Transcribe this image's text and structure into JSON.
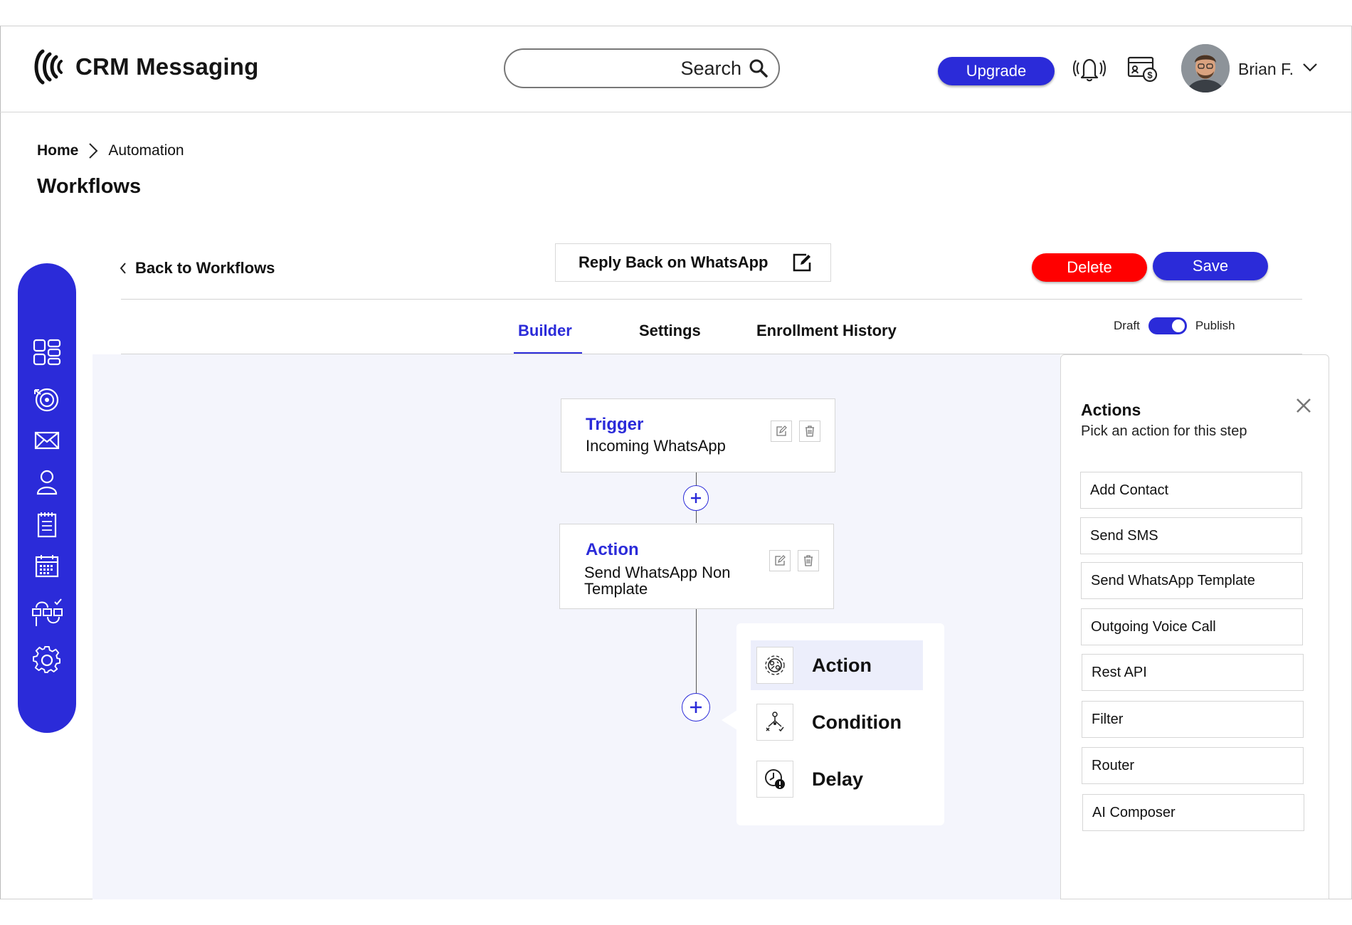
{
  "app": {
    "title": "CRM Messaging"
  },
  "header": {
    "search_placeholder": "Search",
    "upgrade_label": "Upgrade",
    "user_name": "Brian F."
  },
  "breadcrumb": {
    "home": "Home",
    "current": "Automation"
  },
  "page_title": "Workflows",
  "sidebar": {
    "icons": [
      "dashboard-icon",
      "target-icon",
      "mail-icon",
      "contacts-icon",
      "notes-icon",
      "calendar-icon",
      "workflow-icon",
      "settings-icon"
    ]
  },
  "toolbar": {
    "back_label": "Back to Workflows",
    "workflow_name": "Reply Back on WhatsApp",
    "delete_label": "Delete",
    "save_label": "Save"
  },
  "tabs": [
    {
      "label": "Builder",
      "active": true
    },
    {
      "label": "Settings",
      "active": false
    },
    {
      "label": "Enrollment History",
      "active": false
    }
  ],
  "status_toggle": {
    "left_label": "Draft",
    "right_label": "Publish",
    "state": "Publish"
  },
  "builder": {
    "trigger": {
      "title": "Trigger",
      "subtitle": "Incoming WhatsApp"
    },
    "action": {
      "title": "Action",
      "subtitle_line1": "Send WhatsApp Non",
      "subtitle_line2": "Template"
    },
    "step_menu": [
      {
        "label": "Action",
        "icon": "action-gear-icon",
        "highlighted": true
      },
      {
        "label": "Condition",
        "icon": "condition-branch-icon",
        "highlighted": false
      },
      {
        "label": "Delay",
        "icon": "delay-clock-icon",
        "highlighted": false
      }
    ]
  },
  "actions_panel": {
    "title": "Actions",
    "subtitle": "Pick an action for this step",
    "items": [
      "Add Contact",
      "Send SMS",
      "Send WhatsApp Template",
      "Outgoing Voice Call",
      "Rest API",
      "Filter",
      "Router",
      "AI Composer"
    ]
  },
  "colors": {
    "accent": "#2b2bd9",
    "danger": "#ff0000",
    "canvas_bg": "#f4f5fc"
  }
}
